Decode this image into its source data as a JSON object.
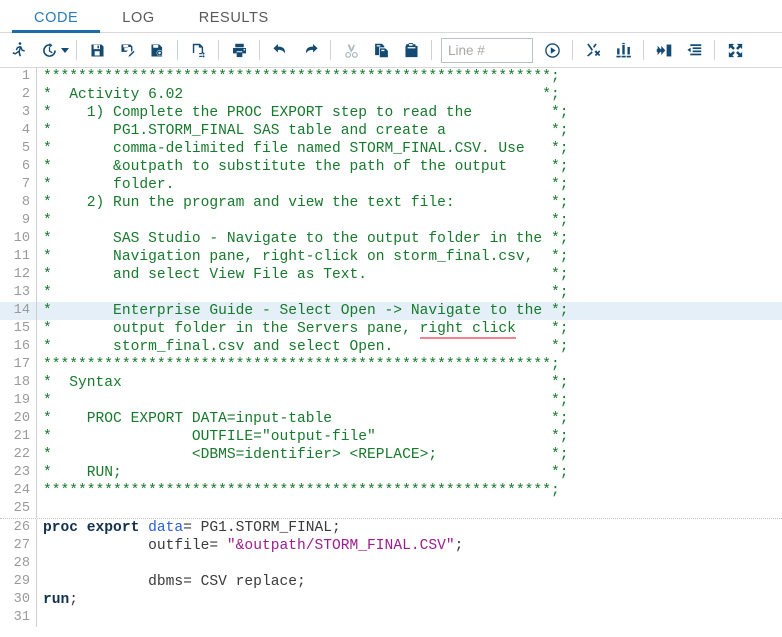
{
  "tabs": [
    {
      "label": "CODE",
      "active": true,
      "name": "tab-code"
    },
    {
      "label": "LOG",
      "active": false,
      "name": "tab-log"
    },
    {
      "label": "RESULTS",
      "active": false,
      "name": "tab-results"
    }
  ],
  "toolbar": {
    "items": [
      {
        "icon": "run-icon",
        "type": "button",
        "disabled": false
      },
      {
        "icon": "history-clock-icon",
        "type": "button",
        "disabled": false
      },
      {
        "icon": "chevron-down-icon",
        "type": "caret",
        "disabled": false
      },
      {
        "icon": "separator",
        "type": "sep"
      },
      {
        "icon": "save-icon",
        "type": "button",
        "disabled": false
      },
      {
        "icon": "save-as-icon",
        "type": "button",
        "disabled": false
      },
      {
        "icon": "save-to-my-folder-icon",
        "type": "button",
        "disabled": false
      },
      {
        "icon": "separator",
        "type": "sep"
      },
      {
        "icon": "code-snippet-icon",
        "type": "button",
        "disabled": false
      },
      {
        "icon": "separator",
        "type": "sep"
      },
      {
        "icon": "print-icon",
        "type": "button",
        "disabled": false
      },
      {
        "icon": "separator",
        "type": "sep"
      },
      {
        "icon": "undo-icon",
        "type": "button",
        "disabled": false
      },
      {
        "icon": "redo-icon",
        "type": "button",
        "disabled": false
      },
      {
        "icon": "separator",
        "type": "sep"
      },
      {
        "icon": "cut-icon",
        "type": "button",
        "disabled": true
      },
      {
        "icon": "copy-icon",
        "type": "button",
        "disabled": false
      },
      {
        "icon": "paste-icon",
        "type": "button",
        "disabled": false
      },
      {
        "icon": "separator",
        "type": "sep"
      },
      {
        "icon": "line-number-input",
        "type": "input"
      },
      {
        "icon": "go-to-line-icon",
        "type": "button",
        "disabled": false
      },
      {
        "icon": "separator",
        "type": "sep"
      },
      {
        "icon": "clear-all-icon",
        "type": "button",
        "disabled": false
      },
      {
        "icon": "analyze-program-icon",
        "type": "button",
        "disabled": false
      },
      {
        "icon": "separator",
        "type": "sep"
      },
      {
        "icon": "add-to-program-icon",
        "type": "button",
        "disabled": false
      },
      {
        "icon": "format-code-icon",
        "type": "button",
        "disabled": false
      },
      {
        "icon": "separator",
        "type": "sep"
      },
      {
        "icon": "maximize-view-icon",
        "type": "button",
        "disabled": false
      }
    ],
    "line_input": {
      "value": "",
      "placeholder": "Line #"
    }
  },
  "colors": {
    "tab_active": "#2a7ab9",
    "comment": "#17792c",
    "keyword": "#10314f",
    "option": "#2b5fd9",
    "string": "#9b1d8f",
    "highlight_row": "#e4eff7",
    "misspell_underline": "#f2808f"
  },
  "editor": {
    "active_line": 14,
    "total_lines": 31,
    "lines": [
      {
        "n": 1,
        "segs": [
          {
            "c": "cm",
            "t": "**********************************************************;"
          }
        ]
      },
      {
        "n": 2,
        "segs": [
          {
            "c": "cm",
            "t": "*  Activity 6.02                                         *;"
          }
        ]
      },
      {
        "n": 3,
        "segs": [
          {
            "c": "cm",
            "t": "*    1) Complete the PROC EXPORT step to read the         *;"
          }
        ]
      },
      {
        "n": 4,
        "segs": [
          {
            "c": "cm",
            "t": "*       PG1.STORM_FINAL SAS table and create a            *;"
          }
        ]
      },
      {
        "n": 5,
        "segs": [
          {
            "c": "cm",
            "t": "*       comma-delimited file named STORM_FINAL.CSV. Use   *;"
          }
        ]
      },
      {
        "n": 6,
        "segs": [
          {
            "c": "cm",
            "t": "*       &outpath to substitute the path of the output     *;"
          }
        ]
      },
      {
        "n": 7,
        "segs": [
          {
            "c": "cm",
            "t": "*       folder.                                           *;"
          }
        ]
      },
      {
        "n": 8,
        "segs": [
          {
            "c": "cm",
            "t": "*    2) Run the program and view the text file:           *;"
          }
        ]
      },
      {
        "n": 9,
        "segs": [
          {
            "c": "cm",
            "t": "*                                                         *;"
          }
        ]
      },
      {
        "n": 10,
        "segs": [
          {
            "c": "cm",
            "t": "*       SAS Studio - Navigate to the output folder in the *;"
          }
        ]
      },
      {
        "n": 11,
        "segs": [
          {
            "c": "cm",
            "t": "*       Navigation pane, right-click on storm_final.csv,  *;"
          }
        ]
      },
      {
        "n": 12,
        "segs": [
          {
            "c": "cm",
            "t": "*       and select View File as Text.                     *;"
          }
        ]
      },
      {
        "n": 13,
        "segs": [
          {
            "c": "cm",
            "t": "*                                                         *;"
          }
        ]
      },
      {
        "n": 14,
        "segs": [
          {
            "c": "cm",
            "t": "*       Enterprise Guide - Select Open -> Navigate to the *;"
          }
        ]
      },
      {
        "n": 15,
        "segs": [
          {
            "c": "cm",
            "t": "*       output folder in the Servers pane, "
          },
          {
            "c": "cm",
            "t": "right click",
            "misspell": true
          },
          {
            "c": "cm",
            "t": "    *;"
          }
        ]
      },
      {
        "n": 16,
        "segs": [
          {
            "c": "cm",
            "t": "*       storm_final.csv and select Open.                  *;"
          }
        ]
      },
      {
        "n": 17,
        "segs": [
          {
            "c": "cm",
            "t": "**********************************************************;"
          }
        ]
      },
      {
        "n": 18,
        "segs": [
          {
            "c": "cm",
            "t": "*  Syntax                                                 *;"
          }
        ]
      },
      {
        "n": 19,
        "segs": [
          {
            "c": "cm",
            "t": "*                                                         *;"
          }
        ]
      },
      {
        "n": 20,
        "segs": [
          {
            "c": "cm",
            "t": "*    PROC EXPORT DATA=input-table                         *;"
          }
        ]
      },
      {
        "n": 21,
        "segs": [
          {
            "c": "cm",
            "t": "*                OUTFILE=\"output-file\"                    *;"
          }
        ]
      },
      {
        "n": 22,
        "segs": [
          {
            "c": "cm",
            "t": "*                <DBMS=identifier> <REPLACE>;             *;"
          }
        ]
      },
      {
        "n": 23,
        "segs": [
          {
            "c": "cm",
            "t": "*    RUN;                                                 *;"
          }
        ]
      },
      {
        "n": 24,
        "segs": [
          {
            "c": "cm",
            "t": "**********************************************************;"
          }
        ]
      },
      {
        "n": 25,
        "segs": []
      },
      {
        "n": 26,
        "sep": true,
        "segs": [
          {
            "c": "kw",
            "t": "proc export "
          },
          {
            "c": "op",
            "t": "data"
          },
          {
            "c": "pl",
            "t": "= PG1.STORM_FINAL;"
          }
        ]
      },
      {
        "n": 27,
        "segs": [
          {
            "c": "pl",
            "t": "            outfile= "
          },
          {
            "c": "str",
            "t": "\"&outpath/STORM_FINAL.CSV\""
          },
          {
            "c": "pl",
            "t": ";"
          }
        ]
      },
      {
        "n": 28,
        "segs": []
      },
      {
        "n": 29,
        "segs": [
          {
            "c": "pl",
            "t": "            dbms= CSV replace;"
          }
        ]
      },
      {
        "n": 30,
        "segs": [
          {
            "c": "kw",
            "t": "run"
          },
          {
            "c": "pl",
            "t": ";"
          }
        ]
      },
      {
        "n": 31,
        "segs": []
      }
    ]
  }
}
